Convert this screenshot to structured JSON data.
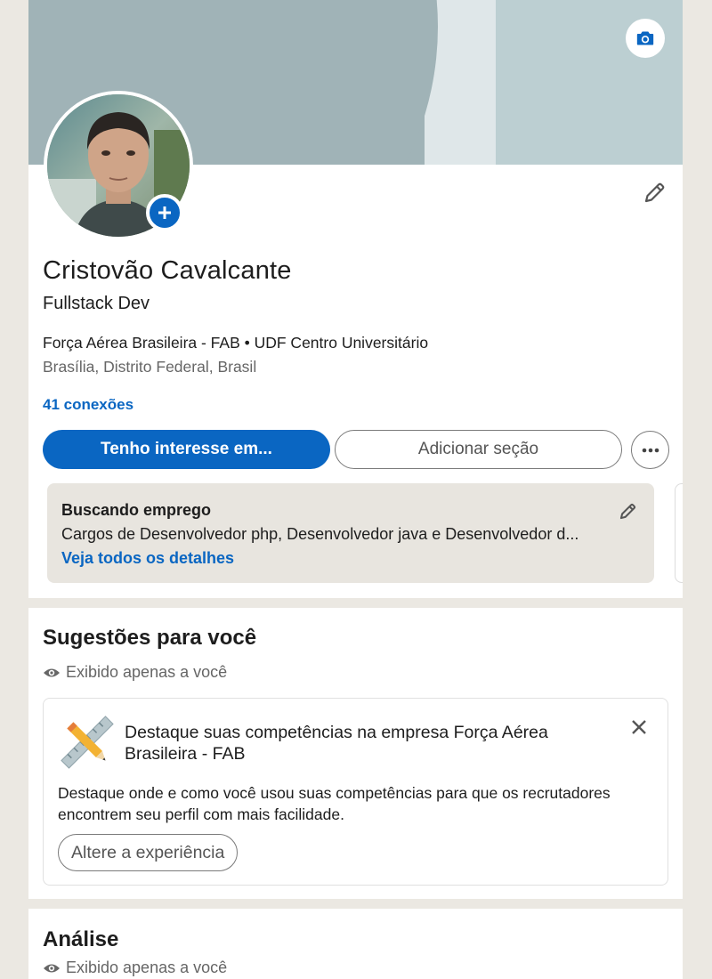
{
  "profile": {
    "name": "Cristovão Cavalcante",
    "headline": "Fullstack Dev",
    "organizations": "Força Aérea Brasileira - FAB • UDF Centro Universitário",
    "location": "Brasília, Distrito Federal, Brasil",
    "connections": "41 conexões"
  },
  "actions": {
    "primary_label": "Tenho interesse em...",
    "secondary_label": "Adicionar seção"
  },
  "open_to_work": {
    "title": "Buscando emprego",
    "description": "Cargos de Desenvolvedor php, Desenvolvedor java e Desenvolvedor d...",
    "link": "Veja todos os detalhes"
  },
  "suggestions": {
    "title": "Sugestões para você",
    "private_note": "Exibido apenas a você",
    "card": {
      "title": "Destaque suas competências na empresa Força Aérea Brasileira - FAB",
      "body": "Destaque onde e como você usou suas competências para que os recrutadores encontrem seu perfil com mais facilidade.",
      "button": "Altere a experiência"
    }
  },
  "analysis": {
    "title": "Análise",
    "private_note": "Exibido apenas a você"
  },
  "colors": {
    "brand_blue": "#0a66c2",
    "page_background": "#ebe8e2",
    "cover_gray": "#a0b3b7"
  },
  "icons": [
    "camera-icon",
    "plus-icon",
    "pencil-icon",
    "more-icon",
    "eye-icon",
    "ruler-pencil-icon",
    "close-icon"
  ]
}
